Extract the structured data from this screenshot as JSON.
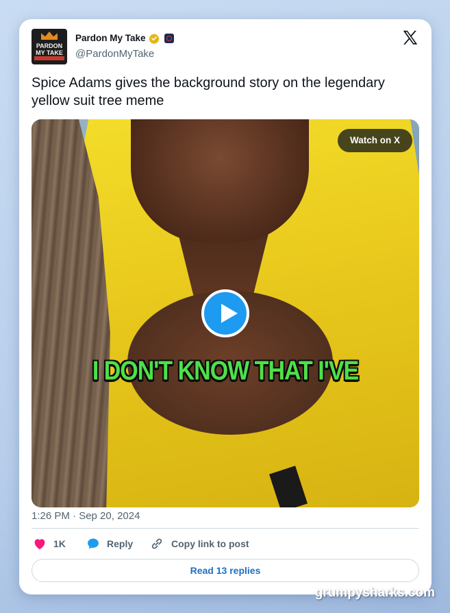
{
  "tweet": {
    "author_name": "Pardon My Take",
    "handle": "@PardonMyTake",
    "avatar_text": "PARDON MY TAKE",
    "text": "Spice Adams gives the background story on the legendary yellow suit tree meme",
    "timestamp": "1:26 PM · Sep 20, 2024"
  },
  "media": {
    "watch_label": "Watch on X",
    "caption": "I DON'T KNOW THAT I'VE",
    "play_icon": "play-icon"
  },
  "actions": {
    "like_count": "1K",
    "reply_label": "Reply",
    "copy_label": "Copy link to post",
    "read_replies_label": "Read 13 replies"
  },
  "watermark": "grumpysharks.com",
  "colors": {
    "accent": "#1d9bf0",
    "like": "#f91880",
    "reply": "#1d9bf0",
    "caption": "#4ee04a"
  }
}
